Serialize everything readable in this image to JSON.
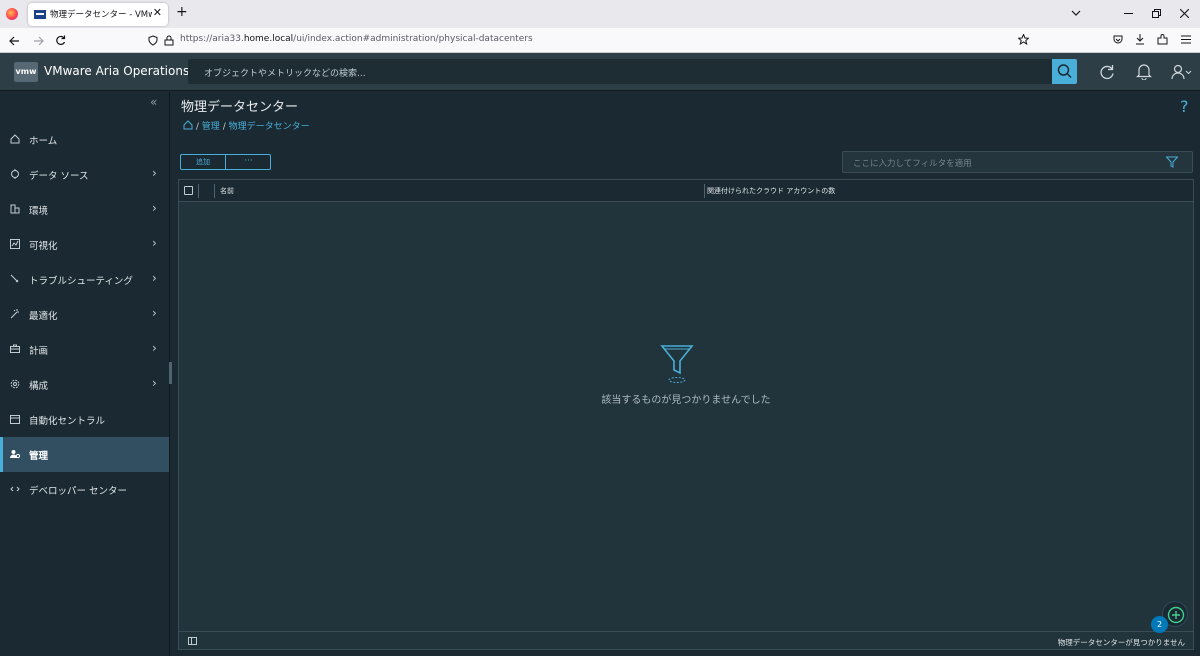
{
  "browser": {
    "tab_title": "物理データセンター - VMware Aria",
    "tab_close": "✕",
    "new_tab": "+",
    "url_prefix": "https://aria33.",
    "url_domain": "home.local",
    "url_path": "/ui/index.action#administration/physical-datacenters"
  },
  "app": {
    "logo": "vmw",
    "title": "VMware Aria Operations",
    "search_placeholder": "オブジェクトやメトリックなどの検索..."
  },
  "sidebar": {
    "items": [
      {
        "label": "ホーム",
        "chevron": ""
      },
      {
        "label": "データ ソース",
        "chevron": "›"
      },
      {
        "label": "環境",
        "chevron": "›"
      },
      {
        "label": "可視化",
        "chevron": "›"
      },
      {
        "label": "トラブルシューティング",
        "chevron": "›"
      },
      {
        "label": "最適化",
        "chevron": "›"
      },
      {
        "label": "計画",
        "chevron": "›"
      },
      {
        "label": "構成",
        "chevron": "›"
      },
      {
        "label": "自動化セントラル",
        "chevron": ""
      },
      {
        "label": "管理",
        "chevron": ""
      },
      {
        "label": "デベロッパー センター",
        "chevron": ""
      }
    ],
    "collapse_glyph": "«"
  },
  "page": {
    "title": "物理データセンター",
    "help": "?",
    "breadcrumb_sep": "/",
    "breadcrumb_admin": "管理",
    "breadcrumb_current": "物理データセンター"
  },
  "toolbar": {
    "add_label": "追加",
    "more_label": "···",
    "filter_placeholder": "ここに入力してフィルタを適用"
  },
  "grid": {
    "columns": [
      "名前",
      "関連付けられたクラウド アカウントの数"
    ],
    "empty_text": "該当するものが見つかりませんでした",
    "footer_text": "物理データセンターが見つかりません"
  },
  "fab": {
    "badge": "2"
  },
  "colors": {
    "accent": "#49afd9",
    "header_bg": "#2d3e47",
    "sidebar_bg": "#1b2a32",
    "active_item": "#324f61"
  }
}
